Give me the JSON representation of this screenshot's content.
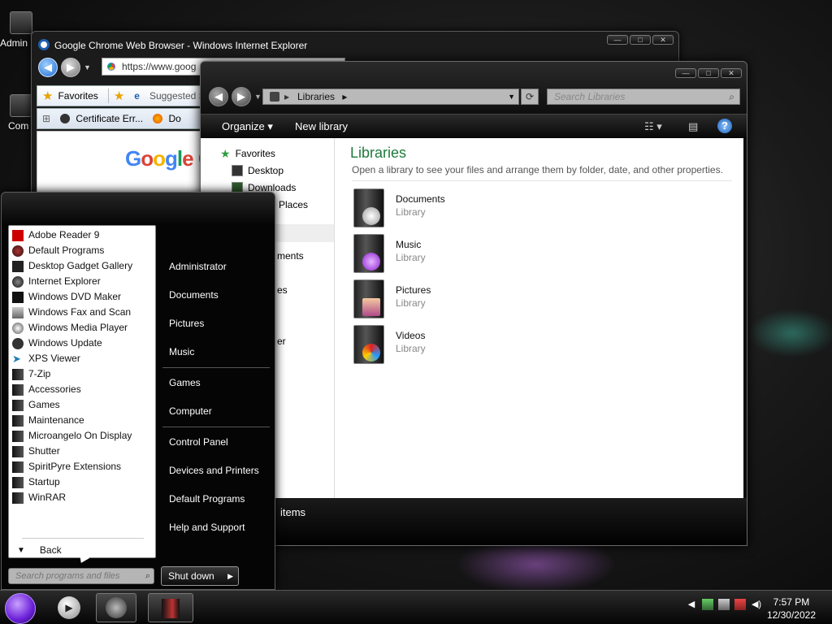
{
  "desktop": {
    "icons": [
      {
        "label": "Admin",
        "icon": "user-folder-icon"
      },
      {
        "label": "Com",
        "icon": "computer-icon"
      }
    ]
  },
  "ie_window": {
    "title": "Google Chrome Web Browser - Windows Internet Explorer",
    "address": "https://www.goog",
    "favorites_label": "Favorites",
    "suggested_label": "Suggested S",
    "tab_label": "Certificate Err...",
    "tab2_label": "Do",
    "page_logo": "Google C"
  },
  "explorer": {
    "breadcrumb": "Libraries",
    "search_placeholder": "Search Libraries",
    "organize_label": "Organize",
    "new_library_label": "New library",
    "nav": {
      "favorites": "Favorites",
      "desktop": "Desktop",
      "downloads": "Downloads",
      "recent_places": "Places",
      "documents_partial": "ments",
      "item6_partial": "es",
      "item7_partial": "er"
    },
    "heading": "Libraries",
    "subheading": "Open a library to see your files and arrange them by folder, date, and other properties.",
    "libraries": [
      {
        "name": "Documents",
        "type": "Library",
        "icon": "documents-library-icon"
      },
      {
        "name": "Music",
        "type": "Library",
        "icon": "music-library-icon"
      },
      {
        "name": "Pictures",
        "type": "Library",
        "icon": "pictures-library-icon"
      },
      {
        "name": "Videos",
        "type": "Library",
        "icon": "videos-library-icon"
      }
    ],
    "status": "items"
  },
  "start_menu": {
    "programs": [
      {
        "label": "Adobe Reader 9",
        "icon": "adobe-reader-icon"
      },
      {
        "label": "Default Programs",
        "icon": "default-programs-icon"
      },
      {
        "label": "Desktop Gadget Gallery",
        "icon": "gadget-gallery-icon"
      },
      {
        "label": "Internet Explorer",
        "icon": "internet-explorer-icon"
      },
      {
        "label": "Windows DVD Maker",
        "icon": "dvd-maker-icon"
      },
      {
        "label": "Windows Fax and Scan",
        "icon": "fax-scan-icon"
      },
      {
        "label": "Windows Media Player",
        "icon": "media-player-icon"
      },
      {
        "label": "Windows Update",
        "icon": "windows-update-icon"
      },
      {
        "label": "XPS Viewer",
        "icon": "xps-viewer-icon"
      },
      {
        "label": "7-Zip",
        "icon": "folder-icon"
      },
      {
        "label": "Accessories",
        "icon": "folder-icon"
      },
      {
        "label": "Games",
        "icon": "folder-icon"
      },
      {
        "label": "Maintenance",
        "icon": "folder-icon"
      },
      {
        "label": "Microangelo On Display",
        "icon": "folder-icon"
      },
      {
        "label": "Shutter",
        "icon": "folder-icon"
      },
      {
        "label": "SpiritPyre Extensions",
        "icon": "folder-icon"
      },
      {
        "label": "Startup",
        "icon": "folder-icon"
      },
      {
        "label": "WinRAR",
        "icon": "folder-icon"
      }
    ],
    "back_label": "Back",
    "search_placeholder": "Search programs and files",
    "right_items": [
      "Administrator",
      "Documents",
      "Pictures",
      "Music",
      "Games",
      "Computer",
      "Control Panel",
      "Devices and Printers",
      "Default Programs",
      "Help and Support"
    ],
    "shutdown_label": "Shut down"
  },
  "taskbar": {
    "time": "7:57 PM",
    "date": "12/30/2022"
  }
}
